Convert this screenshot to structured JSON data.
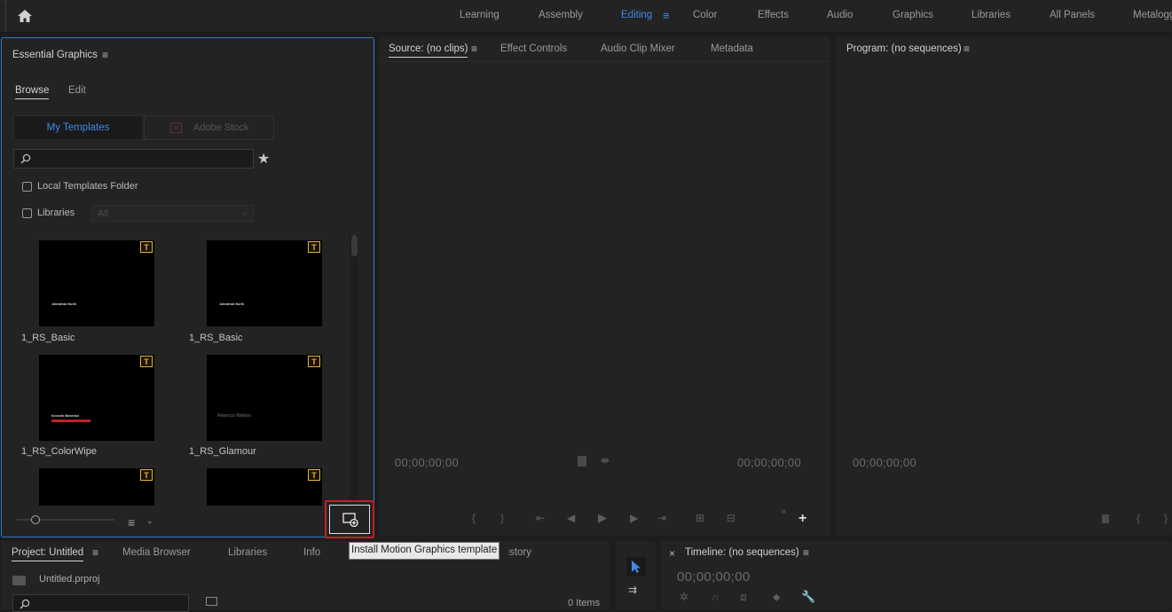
{
  "topbar": {
    "workspaces": [
      "Learning",
      "Assembly",
      "Editing",
      "Color",
      "Effects",
      "Audio",
      "Graphics",
      "Libraries",
      "All Panels",
      "Metalogging"
    ],
    "active": "Editing"
  },
  "essential_graphics": {
    "title": "Essential Graphics",
    "tabs": [
      "Browse",
      "Edit"
    ],
    "seg_my_templates": "My Templates",
    "seg_adobe_stock": "Adobe Stock",
    "stock_badge": "St",
    "search_placeholder": "",
    "local_templates_label": "Local Templates Folder",
    "libraries_label": "Libraries",
    "libraries_select": "All",
    "templates": [
      {
        "label": "1_RS_Basic",
        "preview_text": "Johnathan North"
      },
      {
        "label": "1_RS_Basic",
        "preview_text": "Johnathan North"
      },
      {
        "label": "1_RS_ColorWipe",
        "preview_text": "Kenneth Winterton"
      },
      {
        "label": "1_RS_Glamour",
        "preview_text": "Rebecca Walters"
      },
      {
        "label": "",
        "preview_text": ""
      },
      {
        "label": "",
        "preview_text": ""
      }
    ],
    "badge_text": "T"
  },
  "source": {
    "tabs": [
      "Source: (no clips)",
      "Effect Controls",
      "Audio Clip Mixer",
      "Metadata"
    ],
    "timecode_left": "00;00;00;00",
    "timecode_right": "00;00;00;00"
  },
  "program": {
    "title": "Program: (no sequences)",
    "timecode": "00;00;00;00"
  },
  "tooltip": "Install Motion Graphics template",
  "project": {
    "tabs": [
      "Project: Untitled",
      "Media Browser",
      "Libraries",
      "Info",
      "History"
    ],
    "file": "Untitled.prproj",
    "items_count": "0 Items"
  },
  "timeline": {
    "title": "Timeline: (no sequences)",
    "timecode": "00;00;00;00",
    "close": "×"
  },
  "colors": {
    "accent": "#3e8ae6",
    "highlight_box": "#c0202a",
    "badge": "#e6b43a"
  }
}
